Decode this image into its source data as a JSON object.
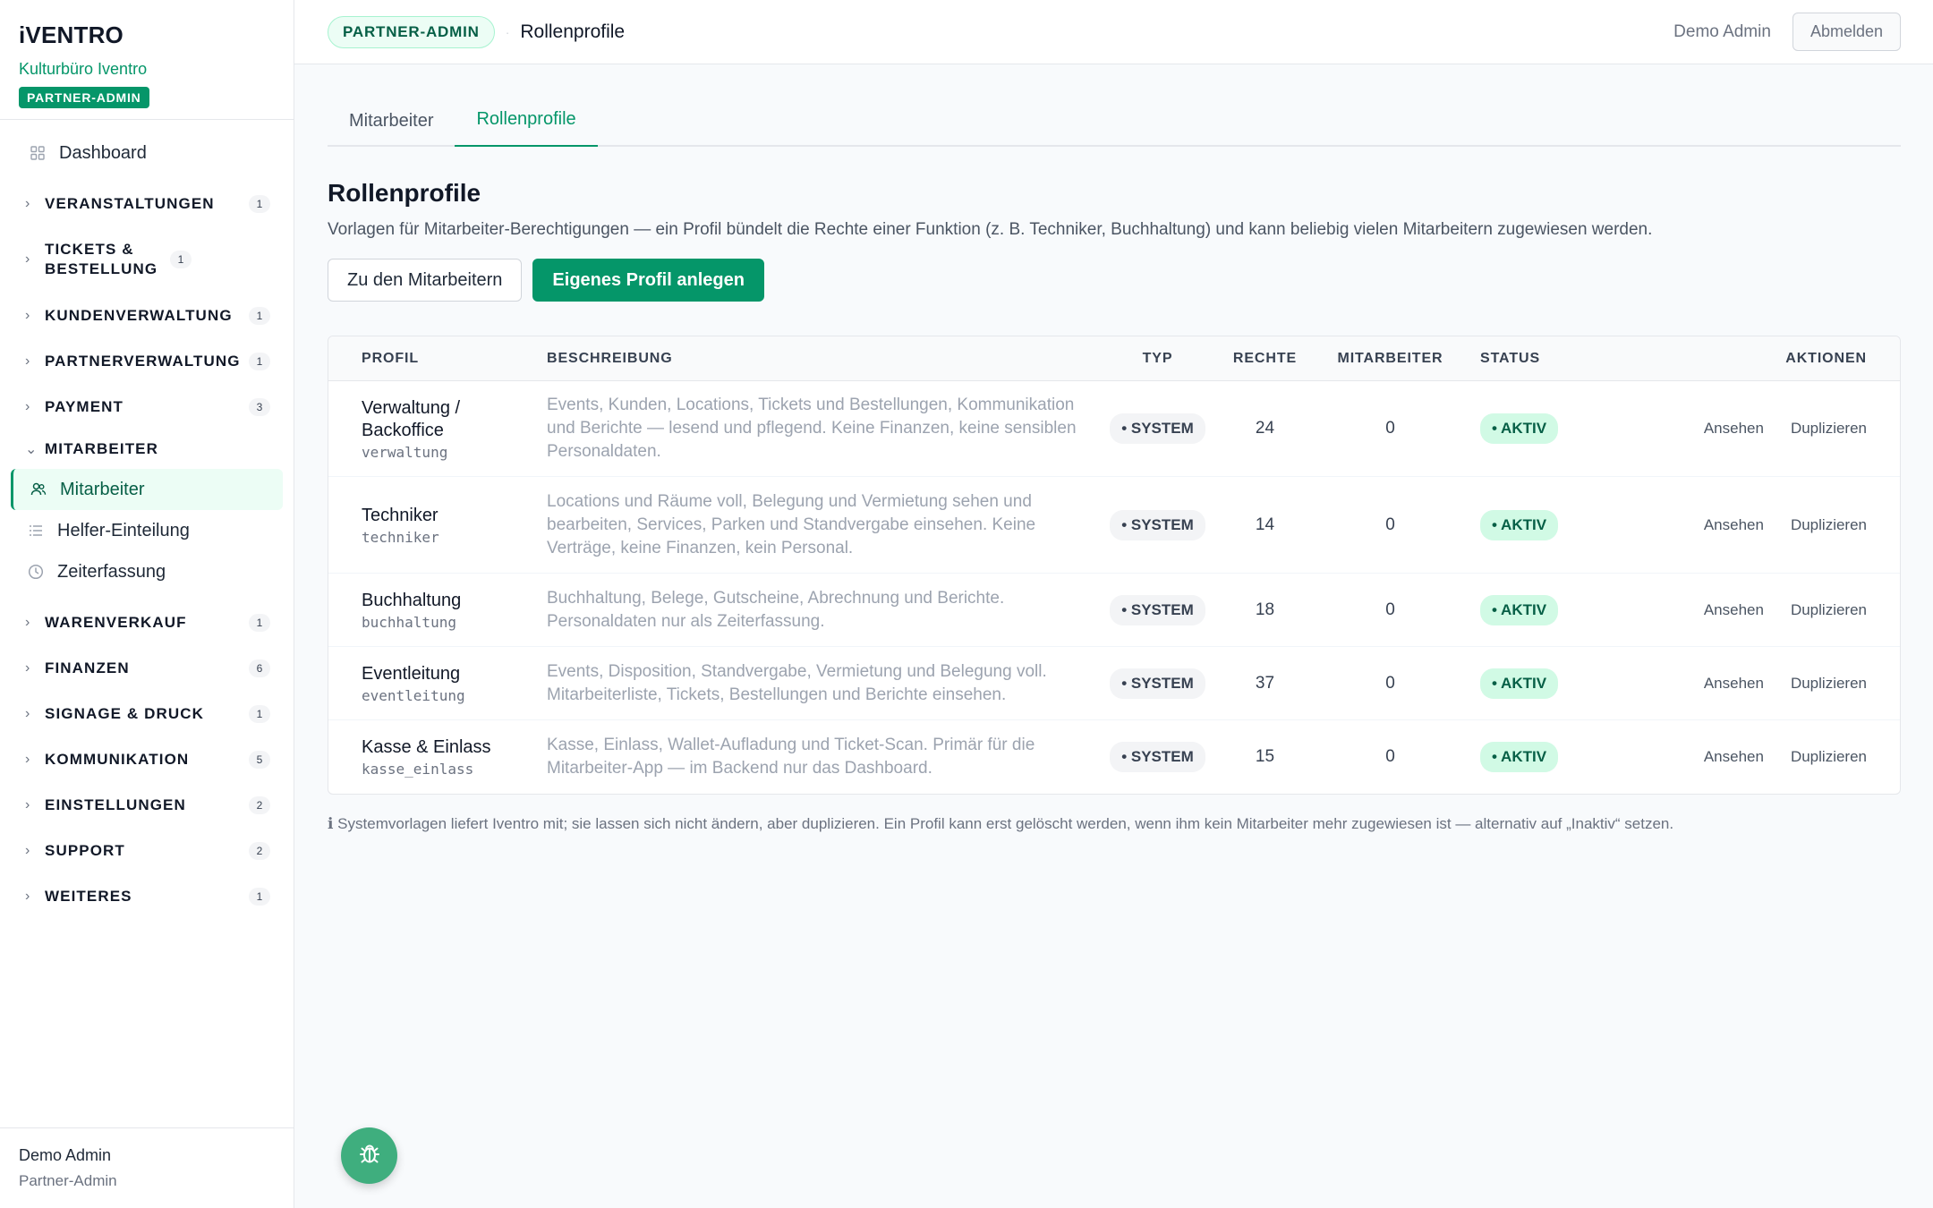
{
  "brand": {
    "logo": "iVENTRO",
    "org": "Kulturbüro Iventro",
    "badge": "PARTNER-ADMIN"
  },
  "nav": {
    "dashboard": "Dashboard",
    "groups": [
      {
        "label": "VERANSTALTUNGEN",
        "count": "1"
      },
      {
        "label": "TICKETS & BESTELLUNG",
        "count": "1"
      },
      {
        "label": "KUNDENVERWALTUNG",
        "count": "1"
      },
      {
        "label": "PARTNERVERWALTUNG",
        "count": "1"
      },
      {
        "label": "PAYMENT",
        "count": "3"
      },
      {
        "label": "MITARBEITER"
      },
      {
        "label": "WARENVERKAUF",
        "count": "1"
      },
      {
        "label": "FINANZEN",
        "count": "6"
      },
      {
        "label": "SIGNAGE & DRUCK",
        "count": "1"
      },
      {
        "label": "KOMMUNIKATION",
        "count": "5"
      },
      {
        "label": "EINSTELLUNGEN",
        "count": "2"
      },
      {
        "label": "SUPPORT",
        "count": "2"
      },
      {
        "label": "WEITERES",
        "count": "1"
      }
    ],
    "mitarbeiter_items": [
      "Mitarbeiter",
      "Helfer-Einteilung",
      "Zeiterfassung"
    ]
  },
  "sidebar_footer": {
    "name": "Demo Admin",
    "role": "Partner-Admin"
  },
  "header": {
    "badge": "PARTNER-ADMIN",
    "title": "Rollenprofile",
    "user": "Demo Admin",
    "logout": "Abmelden"
  },
  "tabs": [
    "Mitarbeiter",
    "Rollenprofile"
  ],
  "page": {
    "title": "Rollenprofile",
    "subtitle": "Vorlagen für Mitarbeiter-Berechtigungen — ein Profil bündelt die Rechte einer Funktion (z. B. Techniker, Buchhaltung) und kann beliebig vielen Mitarbeitern zugewiesen werden.",
    "btn_staff": "Zu den Mitarbeitern",
    "btn_create": "Eigenes Profil anlegen"
  },
  "table": {
    "columns": [
      "PROFIL",
      "BESCHREIBUNG",
      "TYP",
      "RECHTE",
      "MITARBEITER",
      "STATUS",
      "AKTIONEN"
    ],
    "rows": [
      {
        "name": "Verwaltung / Backoffice",
        "slug": "verwaltung",
        "desc": "Events, Kunden, Locations, Tickets und Bestellungen, Kommunikation und Berichte — lesend und pflegend. Keine Finanzen, keine sensiblen Personaldaten.",
        "type": "• SYSTEM",
        "rights": "24",
        "staff": "0",
        "status": "• AKTIV",
        "view": "Ansehen",
        "duplicate": "Duplizieren"
      },
      {
        "name": "Techniker",
        "slug": "techniker",
        "desc": "Locations und Räume voll, Belegung und Vermietung sehen und bearbeiten, Services, Parken und Standvergabe einsehen. Keine Verträge, keine Finanzen, kein Personal.",
        "type": "• SYSTEM",
        "rights": "14",
        "staff": "0",
        "status": "• AKTIV",
        "view": "Ansehen",
        "duplicate": "Duplizieren"
      },
      {
        "name": "Buchhaltung",
        "slug": "buchhaltung",
        "desc": "Buchhaltung, Belege, Gutscheine, Abrechnung und Berichte. Personaldaten nur als Zeiterfassung.",
        "type": "• SYSTEM",
        "rights": "18",
        "staff": "0",
        "status": "• AKTIV",
        "view": "Ansehen",
        "duplicate": "Duplizieren"
      },
      {
        "name": "Eventleitung",
        "slug": "eventleitung",
        "desc": "Events, Disposition, Standvergabe, Vermietung und Belegung voll. Mitarbeiterliste, Tickets, Bestellungen und Berichte einsehen.",
        "type": "• SYSTEM",
        "rights": "37",
        "staff": "0",
        "status": "• AKTIV",
        "view": "Ansehen",
        "duplicate": "Duplizieren"
      },
      {
        "name": "Kasse & Einlass",
        "slug": "kasse_einlass",
        "desc": "Kasse, Einlass, Wallet-Aufladung und Ticket-Scan. Primär für die Mitarbeiter-App — im Backend nur das Dashboard.",
        "type": "• SYSTEM",
        "rights": "15",
        "staff": "0",
        "status": "• AKTIV",
        "view": "Ansehen",
        "duplicate": "Duplizieren"
      }
    ]
  },
  "note": "ℹ Systemvorlagen liefert Iventro mit; sie lassen sich nicht ändern, aber duplizieren. Ein Profil kann erst gelöscht werden, wenn ihm kein Mitarbeiter mehr zugewiesen ist — alternativ auf „Inaktiv“ setzen."
}
